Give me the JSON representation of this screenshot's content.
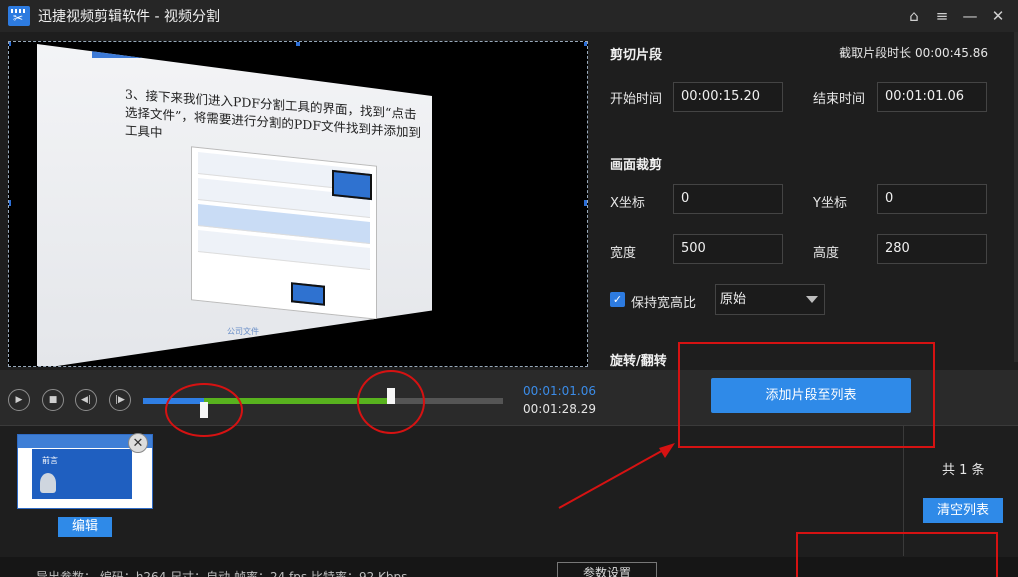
{
  "window": {
    "title": "迅捷视频剪辑软件 - 视频分割",
    "controls": [
      "⌂",
      "≡",
      "—",
      "✕"
    ]
  },
  "preview": {
    "slide_title": "3、接下来我们进入PDF分割工具的界面，找到“点击选择文件”，将需要进行分割的PDF文件找到并添加到工具中",
    "slide_footer": "公司文件"
  },
  "cut": {
    "section": "剪切片段",
    "duration_label": "截取片段时长",
    "duration_value": "00:00:45.86",
    "start_label": "开始时间",
    "start_value": "00:00:15.20",
    "end_label": "结束时间",
    "end_value": "00:01:01.06"
  },
  "crop": {
    "section": "画面裁剪",
    "x_label": "X坐标",
    "x_value": "0",
    "y_label": "Y坐标",
    "y_value": "0",
    "width_label": "宽度",
    "width_value": "500",
    "height_label": "高度",
    "height_value": "280",
    "keep_ratio_label": "保持宽高比",
    "keep_ratio_checked": true,
    "ratio_value": "原始"
  },
  "rotate": {
    "section": "旋转/翻转"
  },
  "playback": {
    "current_time": "00:01:01.06",
    "total_time": "00:01:28.29",
    "played_fraction": 0.17,
    "selection_start_fraction": 0.17,
    "selection_end_fraction": 0.69
  },
  "actions": {
    "add_clip": "添加片段至列表",
    "edit": "编辑",
    "clear_list": "清空列表",
    "count": "共 1 条"
  },
  "clip": {
    "thumb_title": "前言"
  },
  "bottom": {
    "params": "导出参数：  编码：h264    尺寸：自动    帧率：24 fps    比特率：92 Kbps",
    "settings": "参数设置"
  },
  "colors": {
    "accent": "#2f8ae8",
    "selection": "#58b21e",
    "annotation": "#d61212"
  },
  "icons": [
    "home-icon",
    "menu-icon",
    "minimize-icon",
    "close-icon",
    "play-icon",
    "stop-icon",
    "prev-icon",
    "next-icon",
    "checkbox-icon",
    "dropdown-arrow-icon"
  ]
}
